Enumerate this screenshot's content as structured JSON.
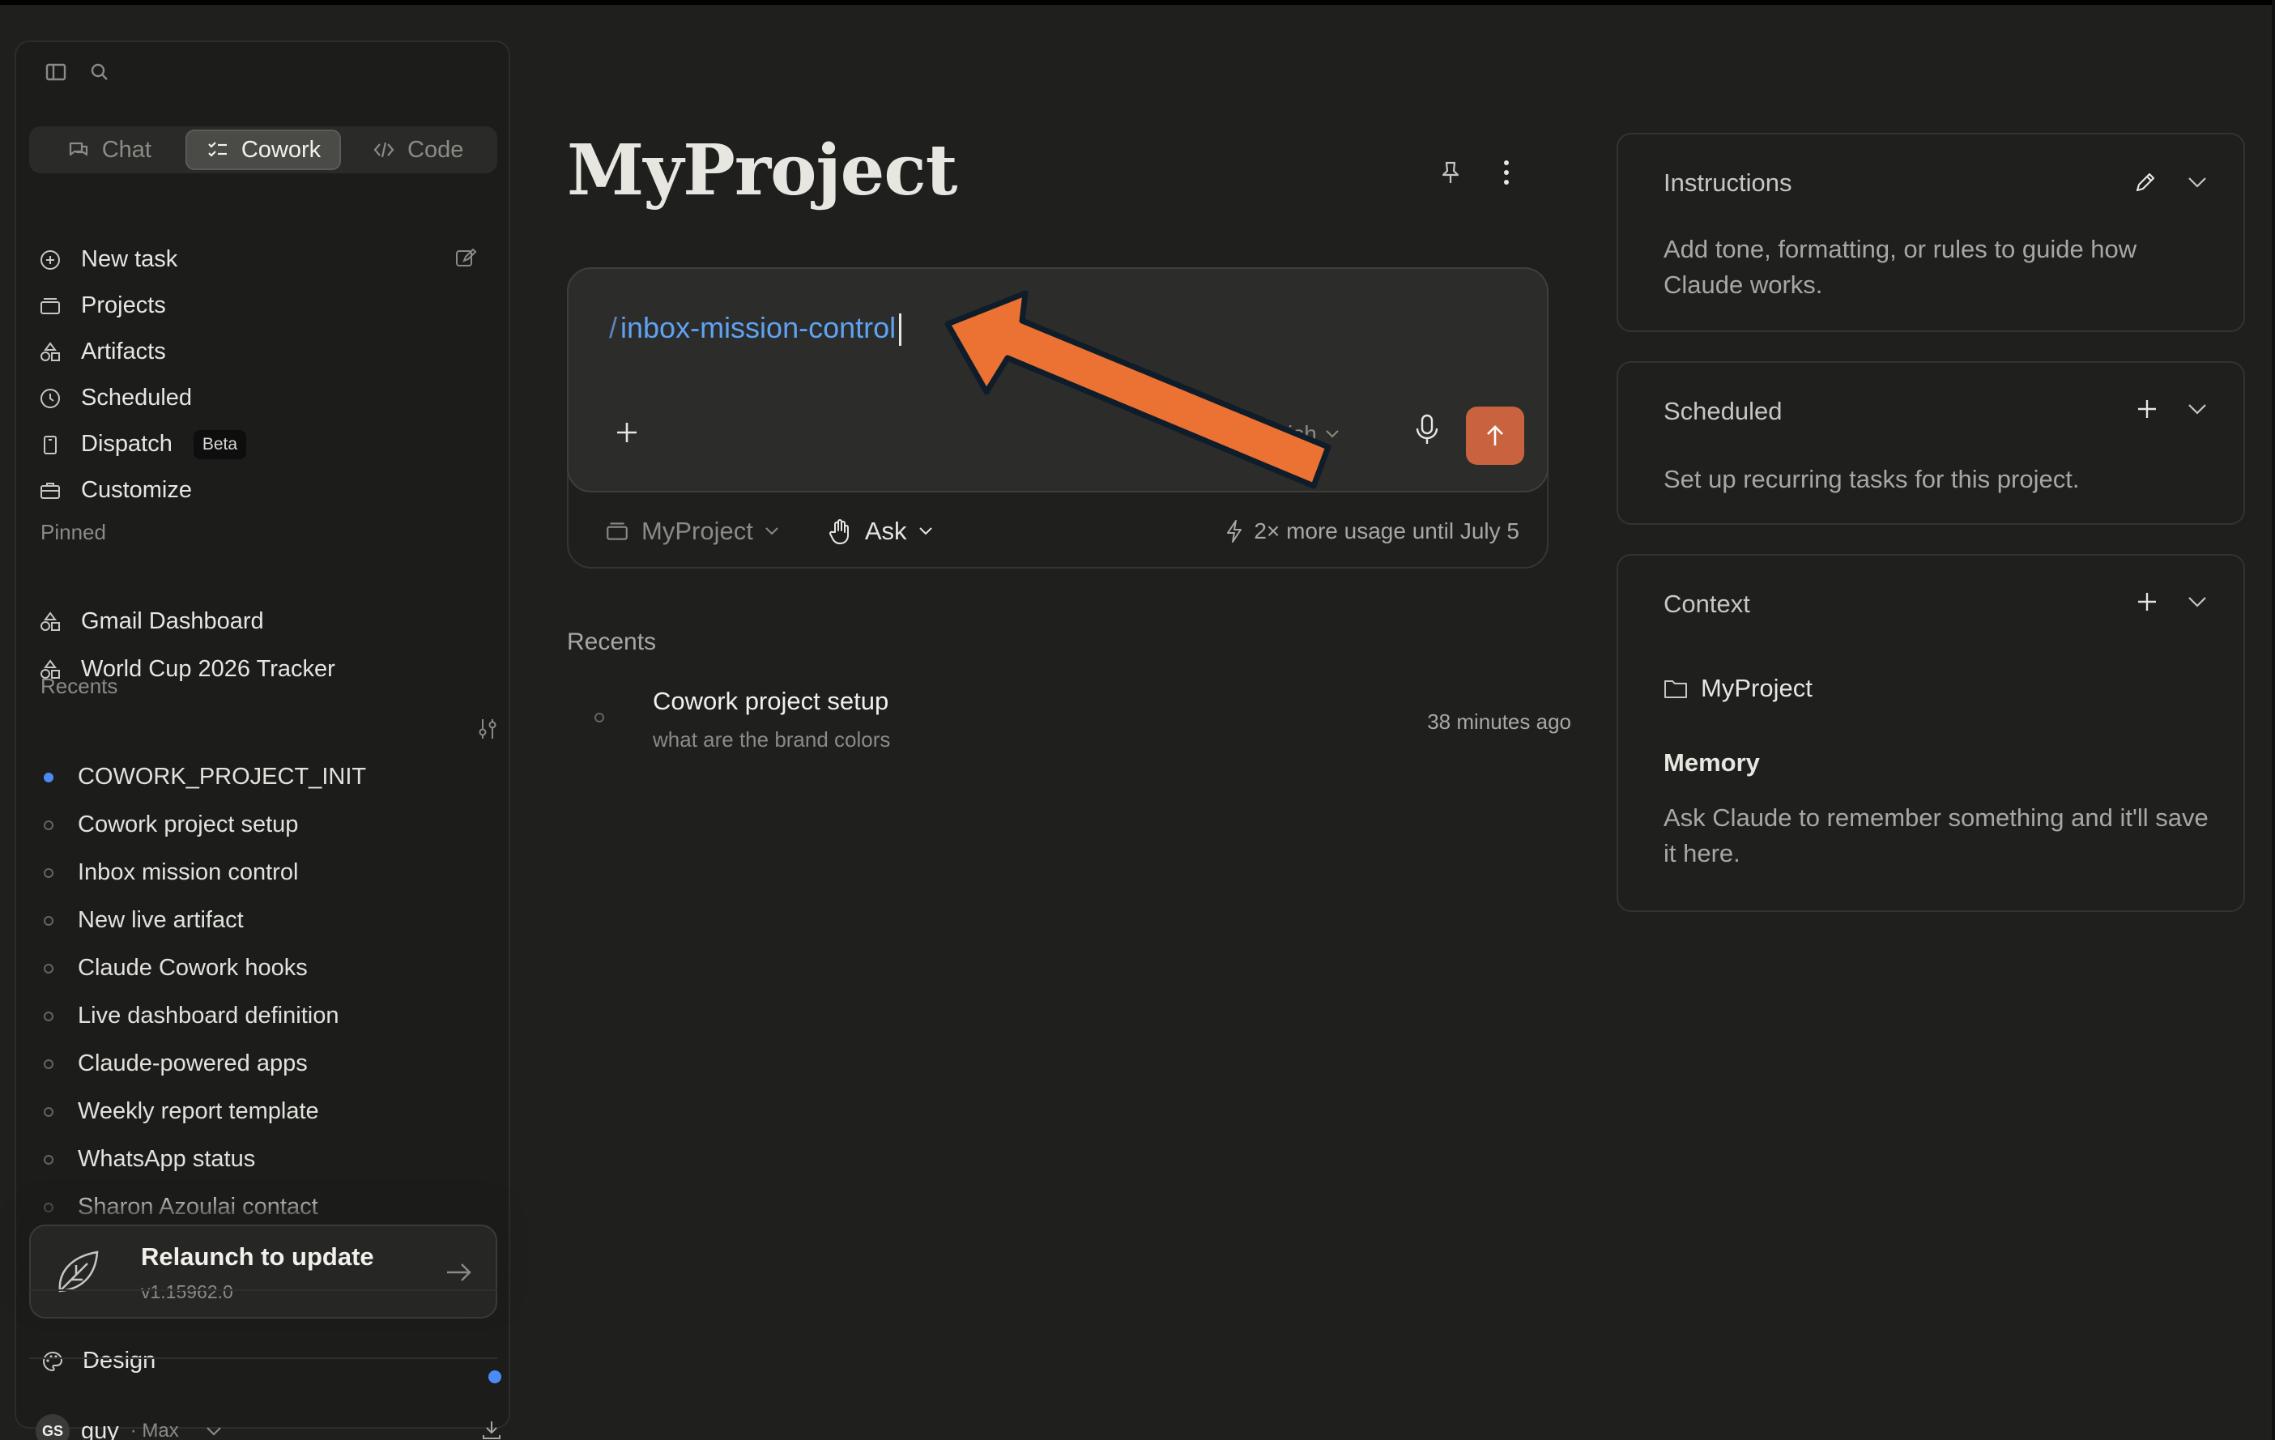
{
  "sidebar": {
    "modes": [
      {
        "label": "Chat",
        "icon": "chat-icon"
      },
      {
        "label": "Cowork",
        "icon": "checklist-icon",
        "active": true
      },
      {
        "label": "Code",
        "icon": "code-icon"
      }
    ],
    "nav": [
      {
        "label": "New task",
        "icon": "plus-circle-icon"
      },
      {
        "label": "Projects",
        "icon": "folder-stack-icon"
      },
      {
        "label": "Artifacts",
        "icon": "shapes-icon"
      },
      {
        "label": "Scheduled",
        "icon": "clock-icon"
      },
      {
        "label": "Dispatch",
        "icon": "phone-icon",
        "badge": "Beta"
      },
      {
        "label": "Customize",
        "icon": "briefcase-icon"
      }
    ],
    "pinned_label": "Pinned",
    "pinned": [
      {
        "label": "Gmail Dashboard",
        "icon": "shapes-icon"
      },
      {
        "label": "World Cup 2026 Tracker",
        "icon": "shapes-icon"
      }
    ],
    "recents_label": "Recents",
    "recents": [
      {
        "label": "COWORK_PROJECT_INIT",
        "active": true
      },
      {
        "label": "Cowork project setup"
      },
      {
        "label": "Inbox mission control"
      },
      {
        "label": "New live artifact"
      },
      {
        "label": "Claude Cowork hooks"
      },
      {
        "label": "Live dashboard definition"
      },
      {
        "label": "Claude-powered apps"
      },
      {
        "label": "Weekly report template"
      },
      {
        "label": "WhatsApp status"
      },
      {
        "label": "Sharon Azoulai contact"
      }
    ],
    "update": {
      "title": "Relaunch to update",
      "version": "v1.15962.0"
    },
    "design_label": "Design",
    "user": {
      "initials": "GS",
      "name": "guy",
      "plan": "· Max"
    }
  },
  "main": {
    "title": "MyProject",
    "composer": {
      "slash": "/",
      "command": "inbox-mission-control",
      "model_partial": "ish"
    },
    "footer": {
      "project": "MyProject",
      "mode": "Ask",
      "usage": "2× more usage until July 5"
    },
    "recents_label": "Recents",
    "recent_items": [
      {
        "title": "Cowork project setup",
        "subtitle": "what are the brand colors",
        "time": "38 minutes ago"
      }
    ]
  },
  "panels": {
    "instructions": {
      "title": "Instructions",
      "text": "Add tone, formatting, or rules to guide how Claude works."
    },
    "scheduled": {
      "title": "Scheduled",
      "text": "Set up recurring tasks for this project."
    },
    "context": {
      "title": "Context",
      "folder": "MyProject",
      "memory_title": "Memory",
      "memory_text": "Ask Claude to remember something and it'll save it here."
    }
  },
  "colors": {
    "accent_send": "#c9623f",
    "annotation_arrow": "#eb7232",
    "command_text": "#5fa2f2",
    "active_dot": "#4c8bf5"
  }
}
